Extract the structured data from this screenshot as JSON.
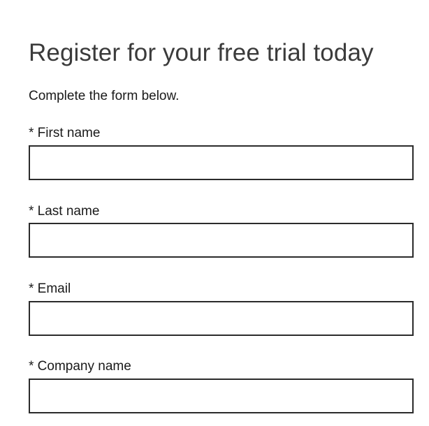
{
  "form": {
    "title": "Register for your free trial today",
    "subtitle": "Complete the form below.",
    "fields": [
      {
        "label": "* First name",
        "value": ""
      },
      {
        "label": "* Last name",
        "value": ""
      },
      {
        "label": "* Email",
        "value": ""
      },
      {
        "label": "* Company name",
        "value": ""
      }
    ]
  }
}
